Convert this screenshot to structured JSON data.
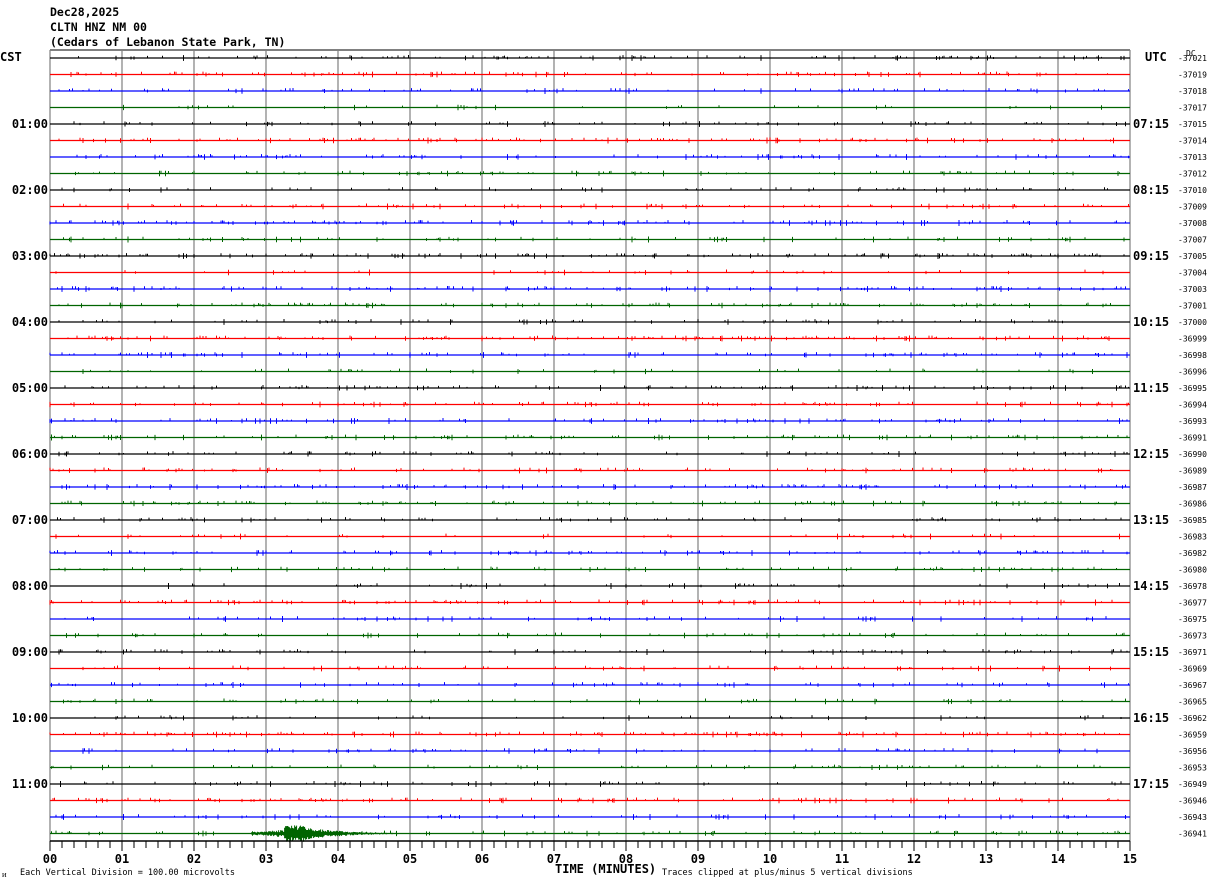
{
  "header": {
    "date": "Dec28,2025",
    "station": "CLTN HNZ NM 00",
    "location": "(Cedars of Lebanon State Park, TN)",
    "left_tz": "CST",
    "right_tz": "UTC",
    "dc_label": "DC"
  },
  "chart_data": {
    "type": "line",
    "subtype": "helicorder",
    "xlabel": "TIME (MINUTES)",
    "xlim": [
      0,
      15
    ],
    "x_ticks": [
      "00",
      "01",
      "02",
      "03",
      "04",
      "05",
      "06",
      "07",
      "08",
      "09",
      "10",
      "11",
      "12",
      "13",
      "14",
      "15"
    ],
    "grid": true,
    "trace_colors": [
      "#000000",
      "#ff0000",
      "#0000ff",
      "#006400"
    ],
    "left_hour_labels": [
      "01:00",
      "02:00",
      "03:00",
      "04:00",
      "05:00",
      "06:00",
      "07:00",
      "08:00",
      "09:00",
      "10:00",
      "11:00"
    ],
    "right_hour_labels": [
      "07:15",
      "08:15",
      "09:15",
      "10:15",
      "11:15",
      "12:15",
      "13:15",
      "14:15",
      "15:15",
      "16:15",
      "17:15"
    ],
    "trace_dc_values": [
      "-37021",
      "-37019",
      "-37018",
      "-37017",
      "-37015",
      "-37014",
      "-37013",
      "-37012",
      "-37010",
      "-37009",
      "-37008",
      "-37007",
      "-37005",
      "-37004",
      "-37003",
      "-37001",
      "-37000",
      "-36999",
      "-36998",
      "-36996",
      "-36995",
      "-36994",
      "-36993",
      "-36991",
      "-36990",
      "-36989",
      "-36987",
      "-36986",
      "-36985",
      "-36983",
      "-36982",
      "-36980",
      "-36978",
      "-36977",
      "-36975",
      "-36973",
      "-36971",
      "-36969",
      "-36967",
      "-36965",
      "-36962",
      "-36959",
      "-36956",
      "-36953",
      "-36949",
      "-36946",
      "-36943",
      "-36941"
    ],
    "event": {
      "trace_index": 47,
      "start_min": 2.8,
      "peak_min": 3.4,
      "end_min": 5.3
    }
  },
  "footer": {
    "scale_note": "Each Vertical Division =  100.00 microvolts",
    "clip_note": "Traces clipped at plus/minus 5 vertical divisions"
  }
}
